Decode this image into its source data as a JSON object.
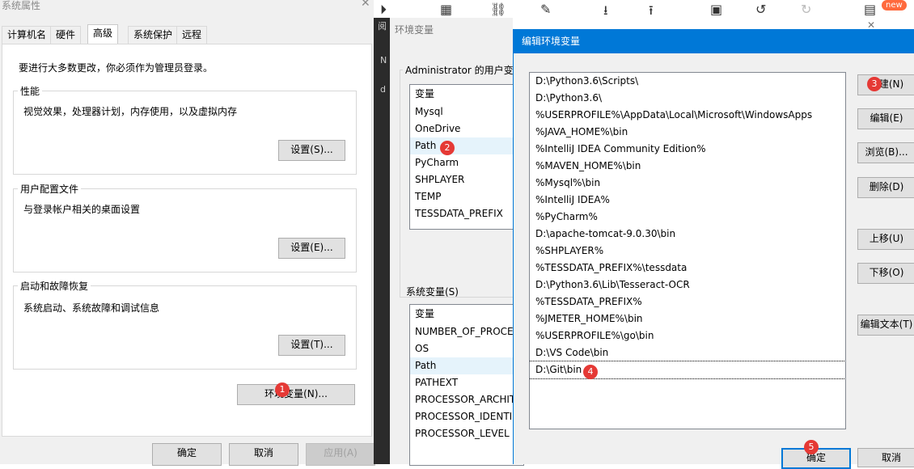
{
  "top_toolbar": {
    "new_badge": "new"
  },
  "sys_props": {
    "title": "系统属性",
    "tabs": [
      "计算机名",
      "硬件",
      "高级",
      "系统保护",
      "远程"
    ],
    "admin_note": "要进行大多数更改，你必须作为管理员登录。",
    "performance": {
      "label": "性能",
      "desc": "视觉效果，处理器计划，内存使用，以及虚拟内存",
      "button": "设置(S)..."
    },
    "user_profiles": {
      "label": "用户配置文件",
      "desc": "与登录帐户相关的桌面设置",
      "button": "设置(E)..."
    },
    "startup": {
      "label": "启动和故障恢复",
      "desc": "系统启动、系统故障和调试信息",
      "button": "设置(T)..."
    },
    "env_button": "环境变量(N)...",
    "ok": "确定",
    "cancel": "取消",
    "apply": "应用(A)"
  },
  "env_vars": {
    "title": "环境变量",
    "user_group_label": "Administrator 的用户变",
    "user_header": "变量",
    "user_vars": [
      "Mysql",
      "OneDrive",
      "Path",
      "PyCharm",
      "SHPLAYER",
      "TEMP",
      "TESSDATA_PREFIX"
    ],
    "system_group_label": "系统变量(S)",
    "system_header": "变量",
    "system_vars": [
      "NUMBER_OF_PROCE",
      "OS",
      "Path",
      "PATHEXT",
      "PROCESSOR_ARCHIT",
      "PROCESSOR_IDENTI",
      "PROCESSOR_LEVEL"
    ],
    "side_fragments": [
      "阅",
      "N",
      "d"
    ]
  },
  "edit_env": {
    "title": "编辑环境变量",
    "paths": [
      "D:\\Python3.6\\Scripts\\",
      "D:\\Python3.6\\",
      "%USERPROFILE%\\AppData\\Local\\Microsoft\\WindowsApps",
      "%JAVA_HOME%\\bin",
      "%IntelliJ IDEA Community Edition%",
      "%MAVEN_HOME%\\bin",
      "%Mysql%\\bin",
      "%IntelliJ IDEA%",
      "%PyCharm%",
      "D:\\apache-tomcat-9.0.30\\bin",
      "%SHPLAYER%",
      "%TESSDATA_PREFIX%\\tessdata",
      "D:\\Python3.6\\Lib\\Tesseract-OCR",
      "%TESSDATA_PREFIX%",
      "%JMETER_HOME%\\bin",
      "%USERPROFILE%\\go\\bin",
      "D:\\VS Code\\bin",
      "D:\\Git\\bin"
    ],
    "buttons": {
      "new": "新建(N)",
      "edit": "编辑(E)",
      "browse": "浏览(B)...",
      "delete": "删除(D)",
      "up": "上移(U)",
      "down": "下移(O)",
      "edit_text": "编辑文本(T)",
      "ok": "确定",
      "cancel": "取消"
    }
  },
  "step_badges": [
    "1",
    "2",
    "3",
    "4",
    "5"
  ],
  "colors": {
    "accent": "#0078d7",
    "badge": "#e53935",
    "selection": "#e5f3fb"
  }
}
